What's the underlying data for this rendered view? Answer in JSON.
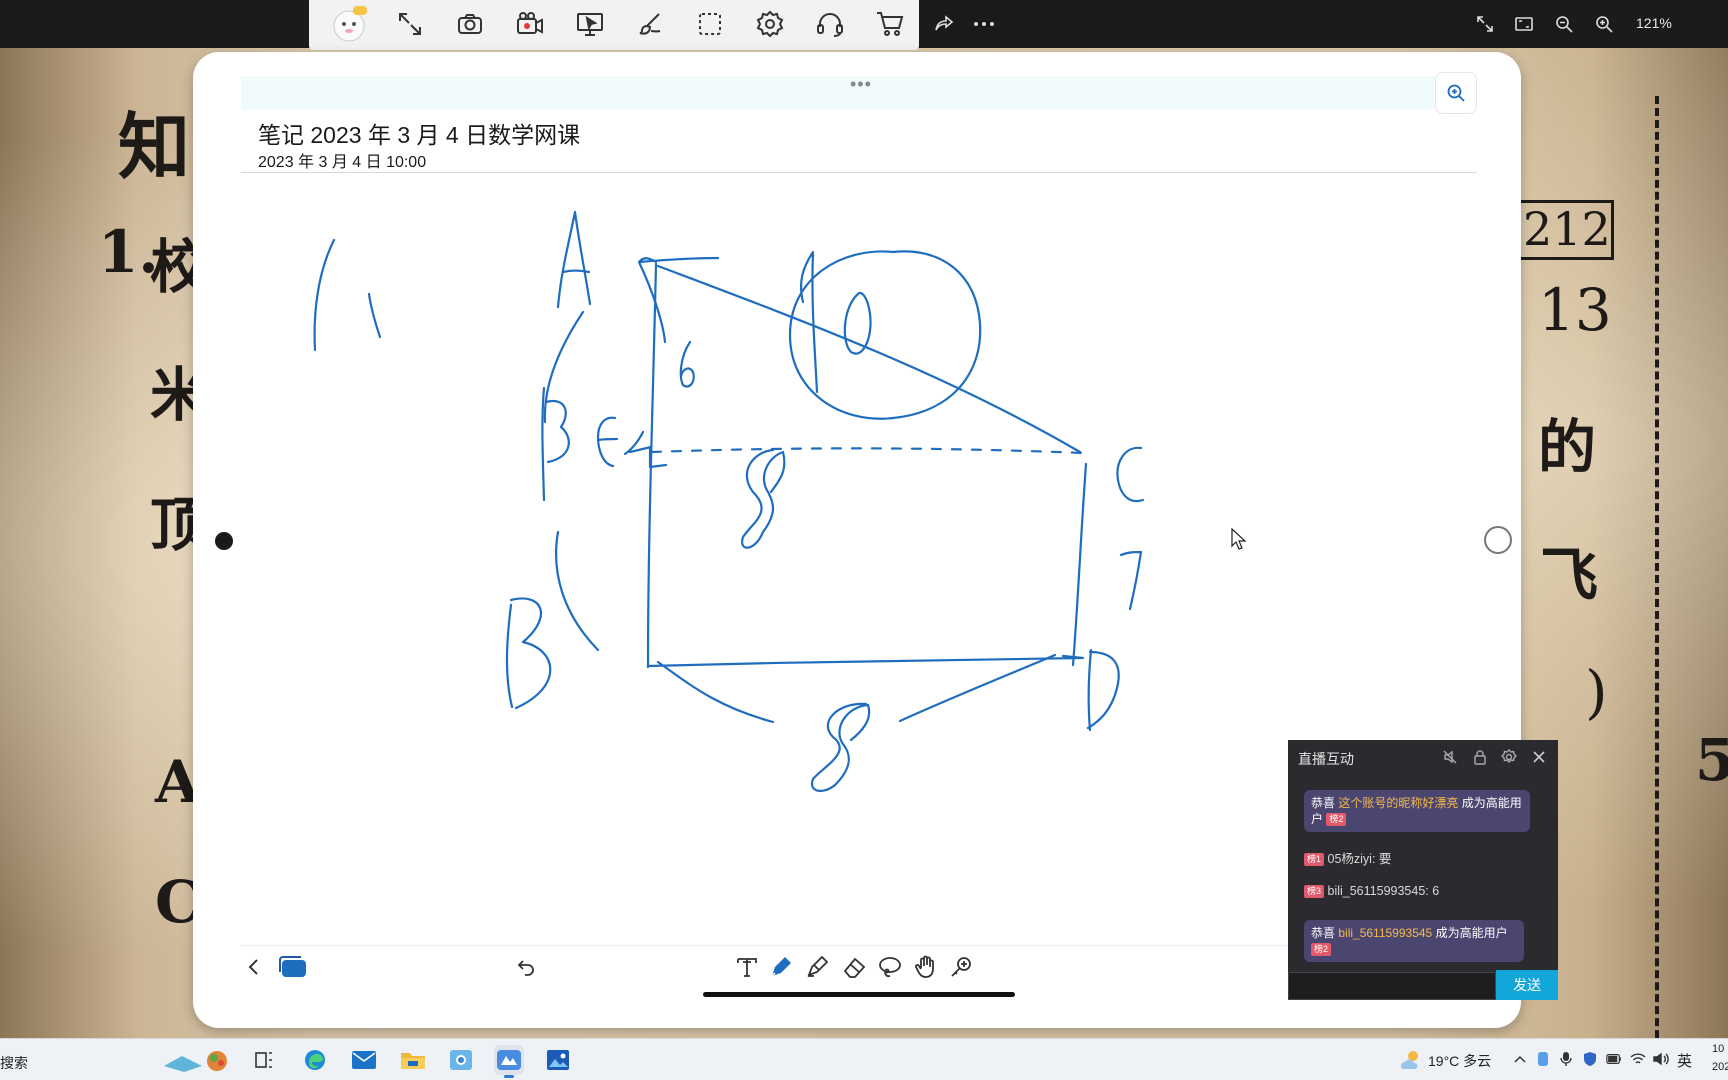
{
  "background": {
    "glyphs": [
      "知",
      "1.",
      "校",
      "米",
      "顶",
      "A",
      "C",
      "212",
      "13",
      "的",
      "飞",
      "5",
      ")"
    ]
  },
  "toolbar": {
    "zoom_level": "121%",
    "icons": [
      "avatar-vip-icon",
      "expand-icon",
      "camera-icon",
      "record-icon",
      "screen-share-icon",
      "brush-icon",
      "select-region-icon",
      "settings-icon",
      "headset-icon",
      "cart-icon",
      "share-icon",
      "more-icon"
    ],
    "right_icons": [
      "fullscreen-icon",
      "fit-window-icon",
      "zoom-out-icon",
      "zoom-in-icon"
    ]
  },
  "note": {
    "title": "笔记 2023 年 3 月 4 日数学网课",
    "datetime": "2023 年 3 月 4 日 10:00",
    "handle": "•••",
    "bottom_tools": [
      "back-icon",
      "pages-icon",
      "undo-icon",
      "text-tool-icon",
      "pen-tool-icon",
      "highlighter-tool-icon",
      "eraser-tool-icon",
      "lasso-tool-icon",
      "hand-tool-icon",
      "shape-tool-icon",
      "microphone-icon"
    ]
  },
  "drawing": {
    "ink_color": "#1f6dbe"
  },
  "chat": {
    "title": "直播互动",
    "messages": [
      {
        "type": "system",
        "prefix": "恭喜",
        "nick": "这个账号的昵称好漂亮",
        "suffix": "成为高能用户",
        "badge": "榜2"
      },
      {
        "type": "chat",
        "badge": "榜1",
        "text": "05杨ziyi: 要"
      },
      {
        "type": "chat",
        "badge": "榜3",
        "text": "bili_56115993545: 6"
      },
      {
        "type": "system",
        "prefix": "恭喜",
        "nick": "bili_56115993545",
        "suffix": "成为高能用户",
        "badge": "榜2"
      }
    ],
    "send_label": "发送",
    "accent": "#13a6d9"
  },
  "taskbar": {
    "search_label": "搜索",
    "weather": "19°C 多云",
    "ime": "英",
    "clock_time": "10",
    "clock_date": "202"
  }
}
